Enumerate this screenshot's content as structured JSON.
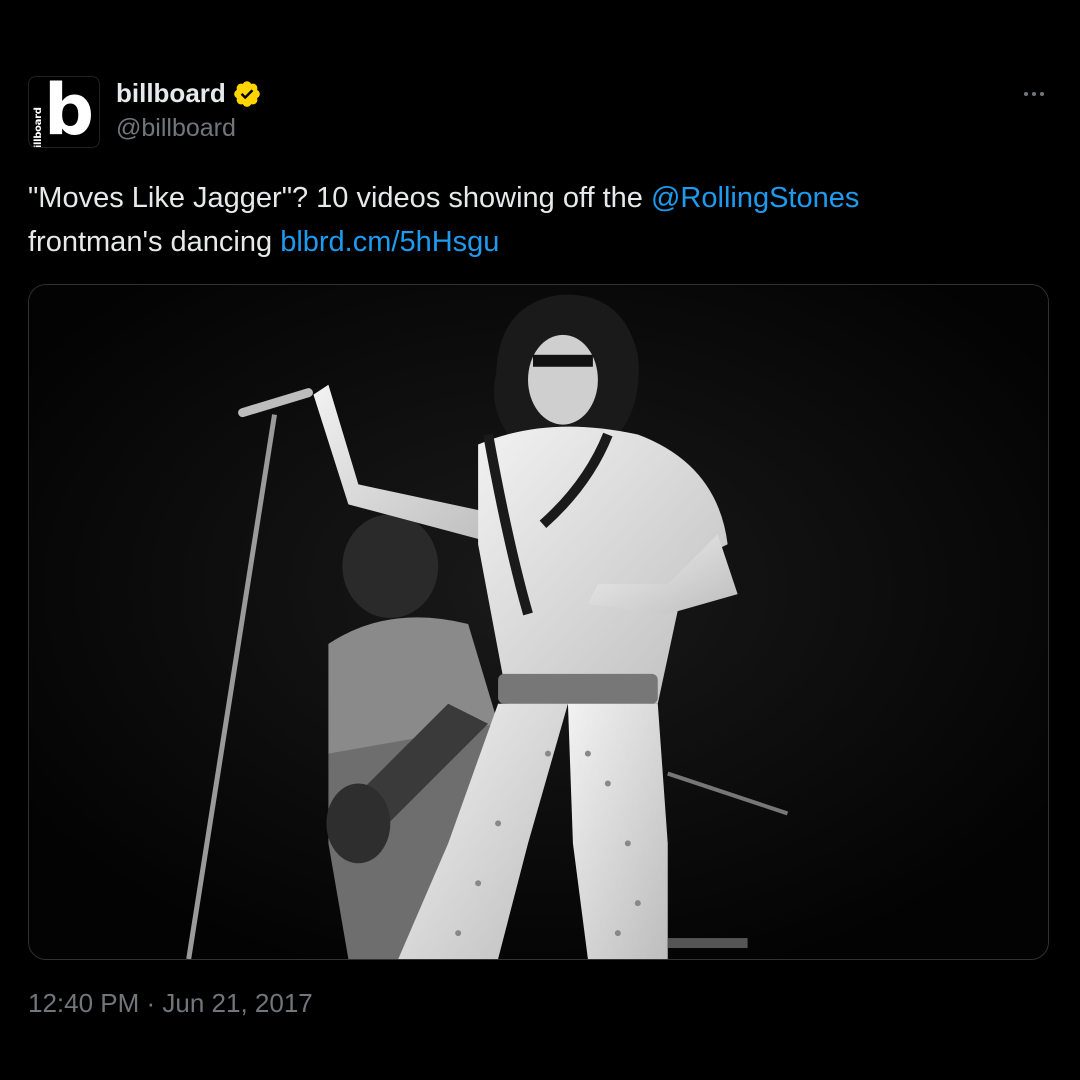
{
  "account": {
    "display_name": "billboard",
    "handle": "@billboard",
    "avatar_letter": "b",
    "avatar_word": "billboard",
    "verified_icon": "verified-gold-badge-icon",
    "verified_color": "#ffd400"
  },
  "tweet": {
    "text_1": "\"Moves Like Jagger\"? 10 videos showing off the ",
    "mention": "@RollingStones",
    "text_2": " frontman's dancing ",
    "link": "blbrd.cm/5hHsgu",
    "timestamp": "12:40 PM · Jun 21, 2017"
  },
  "media": {
    "icon": "photo-icon"
  },
  "colors": {
    "background": "#000000",
    "text": "#e7e9ea",
    "secondary": "#71767b",
    "link": "#1d9bf0"
  }
}
